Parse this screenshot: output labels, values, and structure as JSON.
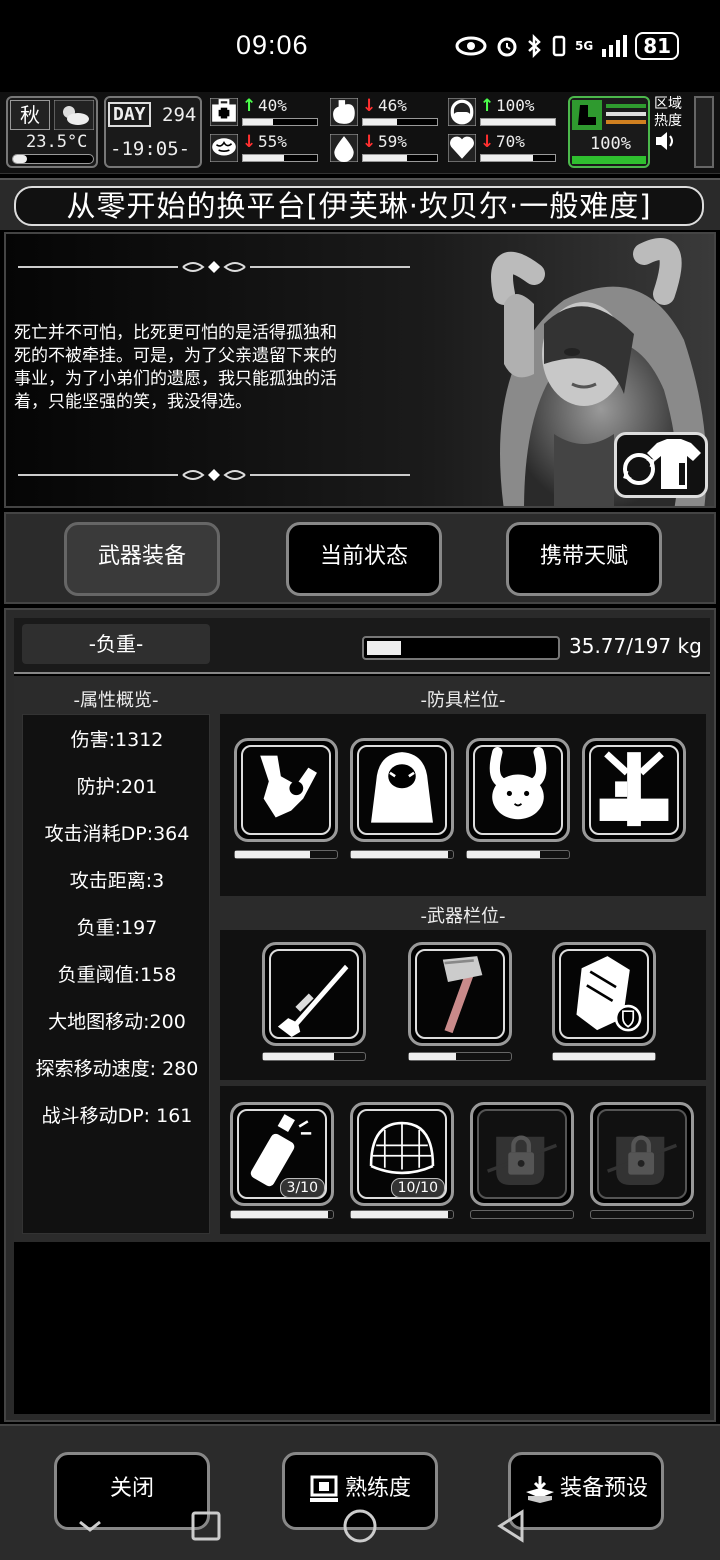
{
  "status_bar": {
    "time": "09:06",
    "network": "5G",
    "battery": "81"
  },
  "hud": {
    "season": "秋",
    "temperature": "23.5°C",
    "day_label": "DAY",
    "day": "294",
    "clock": "-19:05-",
    "stats": [
      {
        "icon": "medkit-icon",
        "trend": "up",
        "value": "40%",
        "fill": 0.4
      },
      {
        "icon": "stomach-icon",
        "trend": "down",
        "value": "46%",
        "fill": 0.46
      },
      {
        "icon": "pill-icon",
        "trend": "up",
        "value": "100%",
        "fill": 1.0
      },
      {
        "icon": "brain-icon",
        "trend": "down",
        "value": "55%",
        "fill": 0.55
      },
      {
        "icon": "water-drop-icon",
        "trend": "down",
        "value": "59%",
        "fill": 0.59
      },
      {
        "icon": "heart-icon",
        "trend": "down",
        "value": "70%",
        "fill": 0.7
      }
    ],
    "stamina": "100%",
    "zone_heat_line1": "区域",
    "zone_heat_line2": "热度"
  },
  "title": "从零开始的换平台[伊芙琳·坎贝尔·一般难度]",
  "story_lines": [
    "死亡并不可怕，比死更可怕的是活得孤独和",
    "死的不被牵挂。可是，为了父亲遗留下来的",
    "事业，为了小弟们的遗愿，我只能孤独的活",
    "着，只能坚强的笑，我没得选。"
  ],
  "tabs": [
    "武器装备",
    "当前状态",
    "携带天赋"
  ],
  "weight": {
    "label": "-负重-",
    "value": "35.77/197 kg",
    "fill": 0.18
  },
  "attributes_title": "-属性概览-",
  "attributes": [
    "伤害:1312",
    "防护:201",
    "攻击消耗DP:364",
    "攻击距离:3",
    "负重:197",
    "负重阈值:158",
    "大地图移动:200",
    "探索移动速度: 280",
    "战斗移动DP: 161"
  ],
  "armor_title": "-防具栏位-",
  "armor_slots": [
    {
      "icon": "weapon-holster-icon",
      "durability": 0.74
    },
    {
      "icon": "hooded-cape-icon",
      "durability": 0.95
    },
    {
      "icon": "bunny-hood-icon",
      "durability": 0.72
    },
    {
      "icon": "frame-pack-icon",
      "durability": null
    }
  ],
  "weapon_title": "-武器栏位-",
  "weapon_slots": [
    {
      "icon": "sniper-rifle-icon",
      "durability": 0.7
    },
    {
      "icon": "sledgehammer-icon",
      "durability": 0.46
    },
    {
      "icon": "riot-shield-icon",
      "durability": 1.0
    }
  ],
  "item_slots": [
    {
      "icon": "spray-can-icon",
      "count": "3/10",
      "durability": 0.95
    },
    {
      "icon": "net-icon",
      "count": "10/10",
      "durability": 0.95
    },
    {
      "icon": "locked-fist-icon",
      "count": null,
      "durability": 0.0
    },
    {
      "icon": "locked-fist-icon",
      "count": null,
      "durability": 0.0
    }
  ],
  "footer": {
    "close": "关闭",
    "proficiency": "熟练度",
    "preset": "装备预设"
  }
}
